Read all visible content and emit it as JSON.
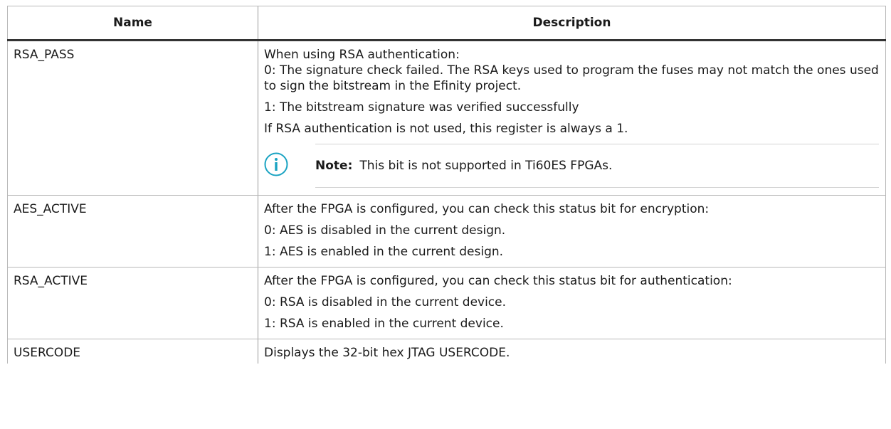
{
  "table": {
    "headers": {
      "name": "Name",
      "description": "Description"
    },
    "rows": [
      {
        "name": "RSA_PASS",
        "lines": [
          "When using RSA authentication:\n0: The signature check failed. The RSA keys used to program the fuses may not match the ones used to sign the bitstream in the Efinity project.",
          "1: The bitstream signature was verified successfully",
          "If RSA authentication is not used, this register is always a 1."
        ],
        "note": {
          "label": "Note:",
          "text": "This bit is not supported in Ti60ES FPGAs."
        }
      },
      {
        "name": "AES_ACTIVE",
        "lines": [
          "After the FPGA is configured, you can check this status bit for encryption:",
          "0: AES is disabled in the current design.",
          "1: AES is enabled in the current design."
        ]
      },
      {
        "name": "RSA_ACTIVE",
        "lines": [
          "After the FPGA is configured, you can check this status bit for authentication:",
          "0: RSA is disabled in the current device.",
          "1: RSA is enabled in the current device."
        ]
      },
      {
        "name": "USERCODE",
        "lines": [
          "Displays the 32-bit hex JTAG USERCODE."
        ]
      }
    ]
  },
  "colors": {
    "info_icon": "#1aa3c2",
    "header_rule": "#333333",
    "grid": "#b8b8b8"
  },
  "icons": {
    "note": "info-circle-icon"
  }
}
